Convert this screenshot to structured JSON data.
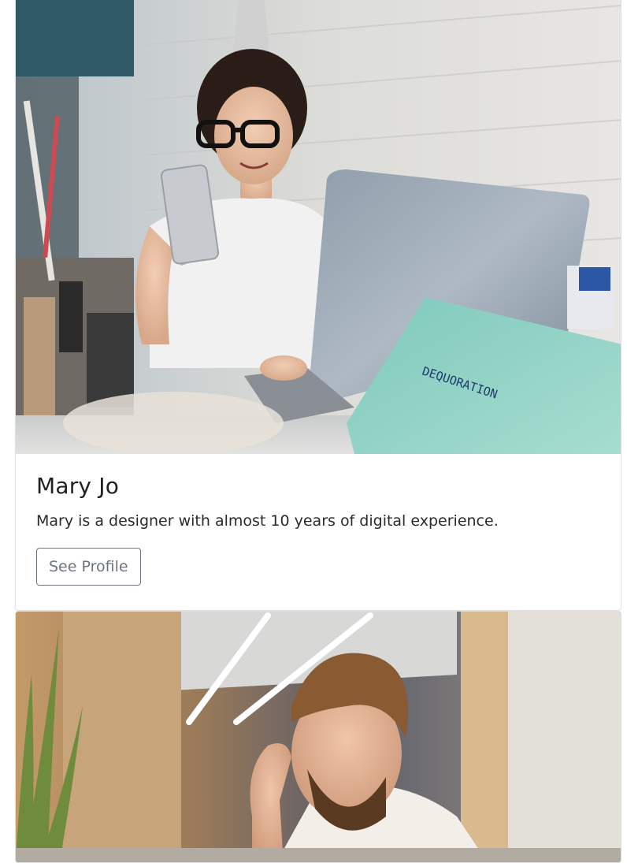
{
  "cards": [
    {
      "photo_alt": "woman-with-phone-and-laptop-photo",
      "name": "Mary Jo",
      "description": "Mary is a designer with almost 10 years of digital experience.",
      "button_label": "See Profile",
      "photo_text": "DEQUORATION"
    },
    {
      "photo_alt": "man-in-office-photo"
    }
  ]
}
